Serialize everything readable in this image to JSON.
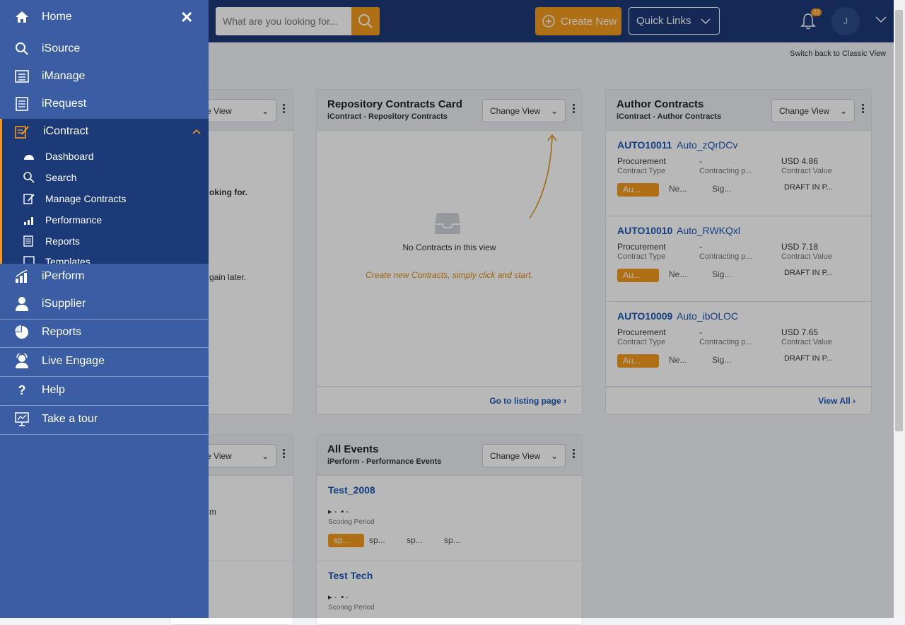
{
  "header": {
    "search_placeholder": "What are you looking for...",
    "create_label": "Create New",
    "quick_links_label": "Quick Links",
    "notif_count": "22",
    "avatar_initial": "J",
    "switch_label": "Switch back to Classic View"
  },
  "colors": {
    "brand": "#1c3a78",
    "accent": "#f39a1e",
    "link": "#1a56b5",
    "sidebar": "#3b5da3"
  },
  "left_cards": {
    "change_view_partial": "ange View",
    "text1": "oking for.",
    "text2": "gain later.",
    "text3": "m"
  },
  "repo_card": {
    "title": "Repository Contracts Card",
    "subtitle": "iContract - Repository Contracts",
    "change_view": "Change View",
    "empty_text": "No Contracts in this view",
    "hint": "Create new Contracts, simply click and start.",
    "footer": "Go to listing page"
  },
  "author_card": {
    "title": "Author Contracts",
    "subtitle": "iContract - Author Contracts",
    "change_view": "Change View",
    "footer": "View All",
    "items": [
      {
        "id": "AUTO10011",
        "name": "Auto_zQrDCv",
        "type_val": "Procurement",
        "type_lbl": "Contract Type",
        "party_val": "-",
        "party_lbl": "Contracting p...",
        "value_val": "USD 4.86",
        "value_lbl": "Contract Value",
        "tag": "Au...",
        "d1": "Ne...",
        "d2": "Sig...",
        "status": "DRAFT IN P..."
      },
      {
        "id": "AUTO10010",
        "name": "Auto_RWKQxl",
        "type_val": "Procurement",
        "type_lbl": "Contract Type",
        "party_val": "-",
        "party_lbl": "Contracting p...",
        "value_val": "USD 7.18",
        "value_lbl": "Contract Value",
        "tag": "Au...",
        "d1": "Ne...",
        "d2": "Sig...",
        "status": "DRAFT IN P..."
      },
      {
        "id": "AUTO10009",
        "name": "Auto_ibOLOC",
        "type_val": "Procurement",
        "type_lbl": "Contract Type",
        "party_val": "-",
        "party_lbl": "Contracting p...",
        "value_val": "USD 7.65",
        "value_lbl": "Contract Value",
        "tag": "Au...",
        "d1": "Ne...",
        "d2": "Sig...",
        "status": "DRAFT IN P..."
      }
    ]
  },
  "events_card": {
    "title": "All Events",
    "subtitle": "iPerform - Performance Events",
    "change_view": "Change View",
    "items": [
      {
        "name": "Test_2008",
        "meta1": "-",
        "meta2": "-",
        "label": "Scoring Period",
        "tag": "sp...",
        "d1": "sp...",
        "d2": "sp...",
        "d3": "sp..."
      },
      {
        "name": "Test Tech",
        "meta1": "-",
        "meta2": "-",
        "label": "Scoring Period"
      }
    ]
  },
  "sidebar": {
    "home": "Home",
    "isource": "iSource",
    "imanage": "iManage",
    "irequest": "iRequest",
    "icontract": "iContract",
    "sub": [
      "Dashboard",
      "Search",
      "Manage Contracts",
      "Performance",
      "Reports",
      "Templates"
    ],
    "iperform": "iPerform",
    "isupplier": "iSupplier",
    "reports": "Reports",
    "live_engage": "Live Engage",
    "help": "Help",
    "tour": "Take a tour"
  }
}
